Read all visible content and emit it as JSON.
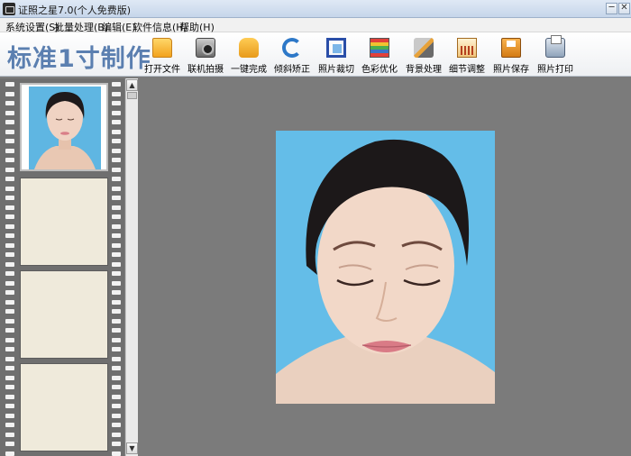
{
  "window": {
    "title": "证照之星7.0(个人免费版)",
    "minimize_glyph": "─",
    "close_glyph": "✕"
  },
  "menu": [
    "系统设置(S)",
    "批量处理(B)",
    "编辑(E)",
    "软件信息(H)",
    "帮助(H)"
  ],
  "toolbar": {
    "brand": "标准1寸制作",
    "tools": [
      {
        "label": "打开文件",
        "icon": "folder-icon"
      },
      {
        "label": "联机拍摄",
        "icon": "camera-icon"
      },
      {
        "label": "一键完成",
        "icon": "hand-icon"
      },
      {
        "label": "倾斜矫正",
        "icon": "rotate-icon"
      },
      {
        "label": "照片裁切",
        "icon": "crop-icon"
      },
      {
        "label": "色彩优化",
        "icon": "color-icon"
      },
      {
        "label": "背景处理",
        "icon": "brush-icon"
      },
      {
        "label": "细节调整",
        "icon": "detail-icon"
      },
      {
        "label": "照片保存",
        "icon": "save-icon"
      },
      {
        "label": "照片打印",
        "icon": "printer-icon"
      }
    ]
  },
  "filmstrip": {
    "frames": 4,
    "selected_index": 0
  },
  "scrollbar": {
    "up_glyph": "▲",
    "down_glyph": "▼"
  },
  "colors": {
    "brand": "#5b7fb0",
    "photo_background": "#64bde8",
    "canvas": "#7b7b7b"
  }
}
